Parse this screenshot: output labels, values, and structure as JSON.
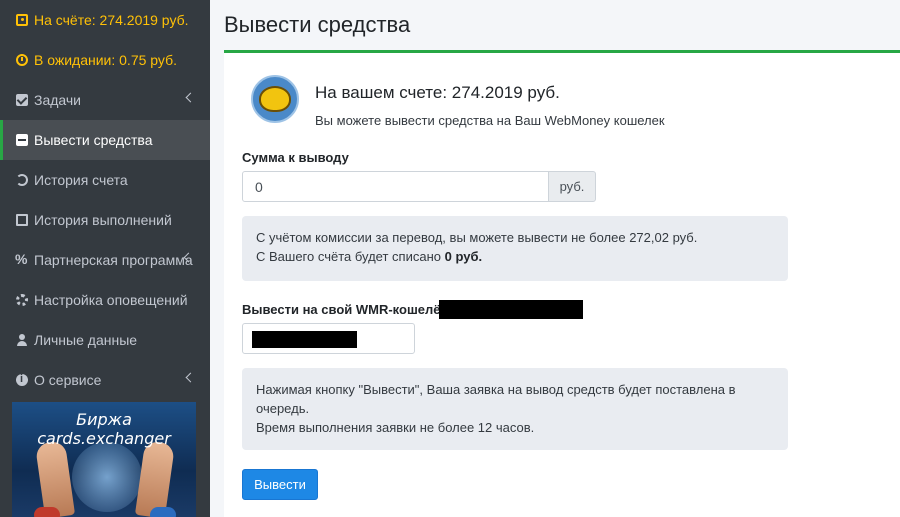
{
  "sidebar": {
    "balance": "На счёте: 274.2019 руб.",
    "pending": "В ожидании: 0.75 руб.",
    "items": [
      {
        "label": "Задачи"
      },
      {
        "label": "Вывести средства"
      },
      {
        "label": "История счета"
      },
      {
        "label": "История выполнений"
      },
      {
        "label": "Партнерская программа"
      },
      {
        "label": "Настройка оповещений"
      },
      {
        "label": "Личные данные"
      },
      {
        "label": "О сервисе"
      }
    ],
    "banner_title": "Биржа cards.exchanger"
  },
  "main": {
    "title": "Вывести средства",
    "balance_title": "На вашем счете: 274.2019 руб.",
    "balance_sub": "Вы можете вывести средства на Ваш WebMoney кошелек",
    "amount_label": "Сумма к выводу",
    "amount_value": "0",
    "amount_suffix": "руб.",
    "commission_line1": "С учётом комиссии за перевод, вы можете вывести не более 272,02 руб.",
    "commission_line2_prefix": "С Вашего счёта будет списано ",
    "commission_line2_amount": "0 руб.",
    "wmr_label": "Вывести на свой WMR-кошелёк",
    "notice_line1": "Нажимая кнопку \"Вывести\", Ваша заявка на вывод средств будет поставлена в очередь.",
    "notice_line2": "Время выполнения заявки не более 12 часов.",
    "submit_label": "Вывести"
  },
  "colors": {
    "sidebar_bg": "#343a40",
    "accent_green": "#28a745",
    "accent_yellow": "#ffc107",
    "button_blue": "#1e88e5"
  }
}
